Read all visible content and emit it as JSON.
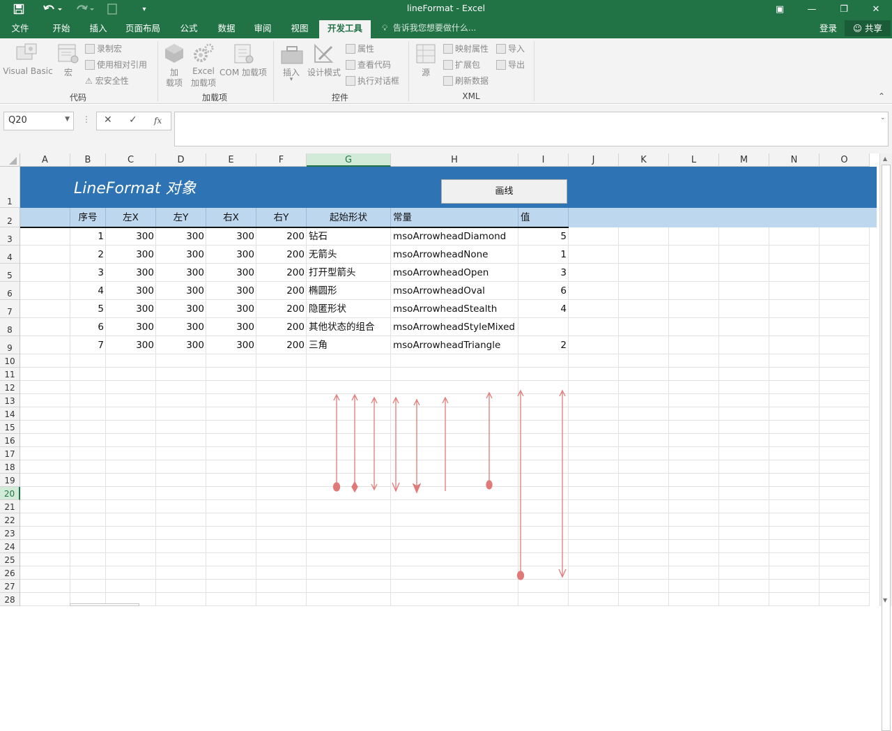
{
  "window": {
    "title": "lineFormat - Excel",
    "qa": {
      "save_icon": "save-icon",
      "undo_icon": "undo-icon",
      "redo_icon": "redo-icon",
      "customize_icon": "customize-icon"
    },
    "controls": {
      "ribbon_display": "▣",
      "minimize": "—",
      "restore": "❐",
      "close": "✕"
    }
  },
  "tabs": [
    "文件",
    "开始",
    "插入",
    "页面布局",
    "公式",
    "数据",
    "审阅",
    "视图",
    "开发工具"
  ],
  "active_tab": "开发工具",
  "tell_me": "告诉我您想要做什么...",
  "account": {
    "login": "登录",
    "share": "共享"
  },
  "ribbon": {
    "code": {
      "group": "代码",
      "visual_basic": "Visual Basic",
      "macro": "宏",
      "record_macro": "录制宏",
      "relative_ref": "使用相对引用",
      "macro_security": "宏安全性"
    },
    "addins": {
      "group": "加载项",
      "addins_line1": "加",
      "addins_line2": "载项",
      "excel_line1": "Excel",
      "excel_line2": "加载项",
      "com": "COM 加载项"
    },
    "controls": {
      "group": "控件",
      "insert": "插入",
      "design_mode": "设计模式",
      "properties": "属性",
      "view_code": "查看代码",
      "run_dialog": "执行对话框"
    },
    "xml": {
      "group": "XML",
      "source": "源",
      "map_props": "映射属性",
      "expansion": "扩展包",
      "refresh": "刷新数据",
      "import": "导入",
      "export": "导出"
    }
  },
  "formula_bar": {
    "name_box": "Q20",
    "cancel": "✕",
    "enter": "✓",
    "fx": "fx",
    "value": ""
  },
  "columns": [
    "A",
    "B",
    "C",
    "D",
    "E",
    "F",
    "G",
    "H",
    "I",
    "J",
    "K",
    "L",
    "M",
    "N",
    "O"
  ],
  "selected_column": "G",
  "rows": [
    "1",
    "2",
    "3",
    "4",
    "5",
    "6",
    "7",
    "8",
    "9",
    "10",
    "11",
    "12",
    "13",
    "14",
    "15",
    "16",
    "17",
    "18",
    "19",
    "20",
    "21",
    "22",
    "23",
    "24",
    "25",
    "26",
    "27",
    "28"
  ],
  "selected_row": "20",
  "sheet": {
    "title": "LineFormat 对象",
    "button": "画线",
    "headers": [
      "序号",
      "左X",
      "左Y",
      "右X",
      "右Y",
      "起始形状",
      "常量",
      "值"
    ],
    "data": [
      [
        "1",
        "300",
        "300",
        "300",
        "200",
        "钻石",
        "msoArrowheadDiamond",
        "5"
      ],
      [
        "2",
        "300",
        "300",
        "300",
        "200",
        "无箭头",
        "msoArrowheadNone",
        "1"
      ],
      [
        "3",
        "300",
        "300",
        "300",
        "200",
        "打开型箭头",
        "msoArrowheadOpen",
        "3"
      ],
      [
        "4",
        "300",
        "300",
        "300",
        "200",
        "椭圆形",
        "msoArrowheadOval",
        "6"
      ],
      [
        "5",
        "300",
        "300",
        "300",
        "200",
        "隐匿形状",
        "msoArrowheadStealth",
        "4"
      ],
      [
        "6",
        "300",
        "300",
        "300",
        "200",
        "其他状态的组合",
        "msoArrowheadStyleMixed",
        ""
      ],
      [
        "7",
        "300",
        "300",
        "300",
        "200",
        "三角",
        "msoArrowheadTriangle",
        "2"
      ]
    ]
  },
  "colors": {
    "title_bar": "#217346",
    "banner": "#2e74b5",
    "header_row": "#bdd7ee",
    "arrow": "#e07a78"
  }
}
